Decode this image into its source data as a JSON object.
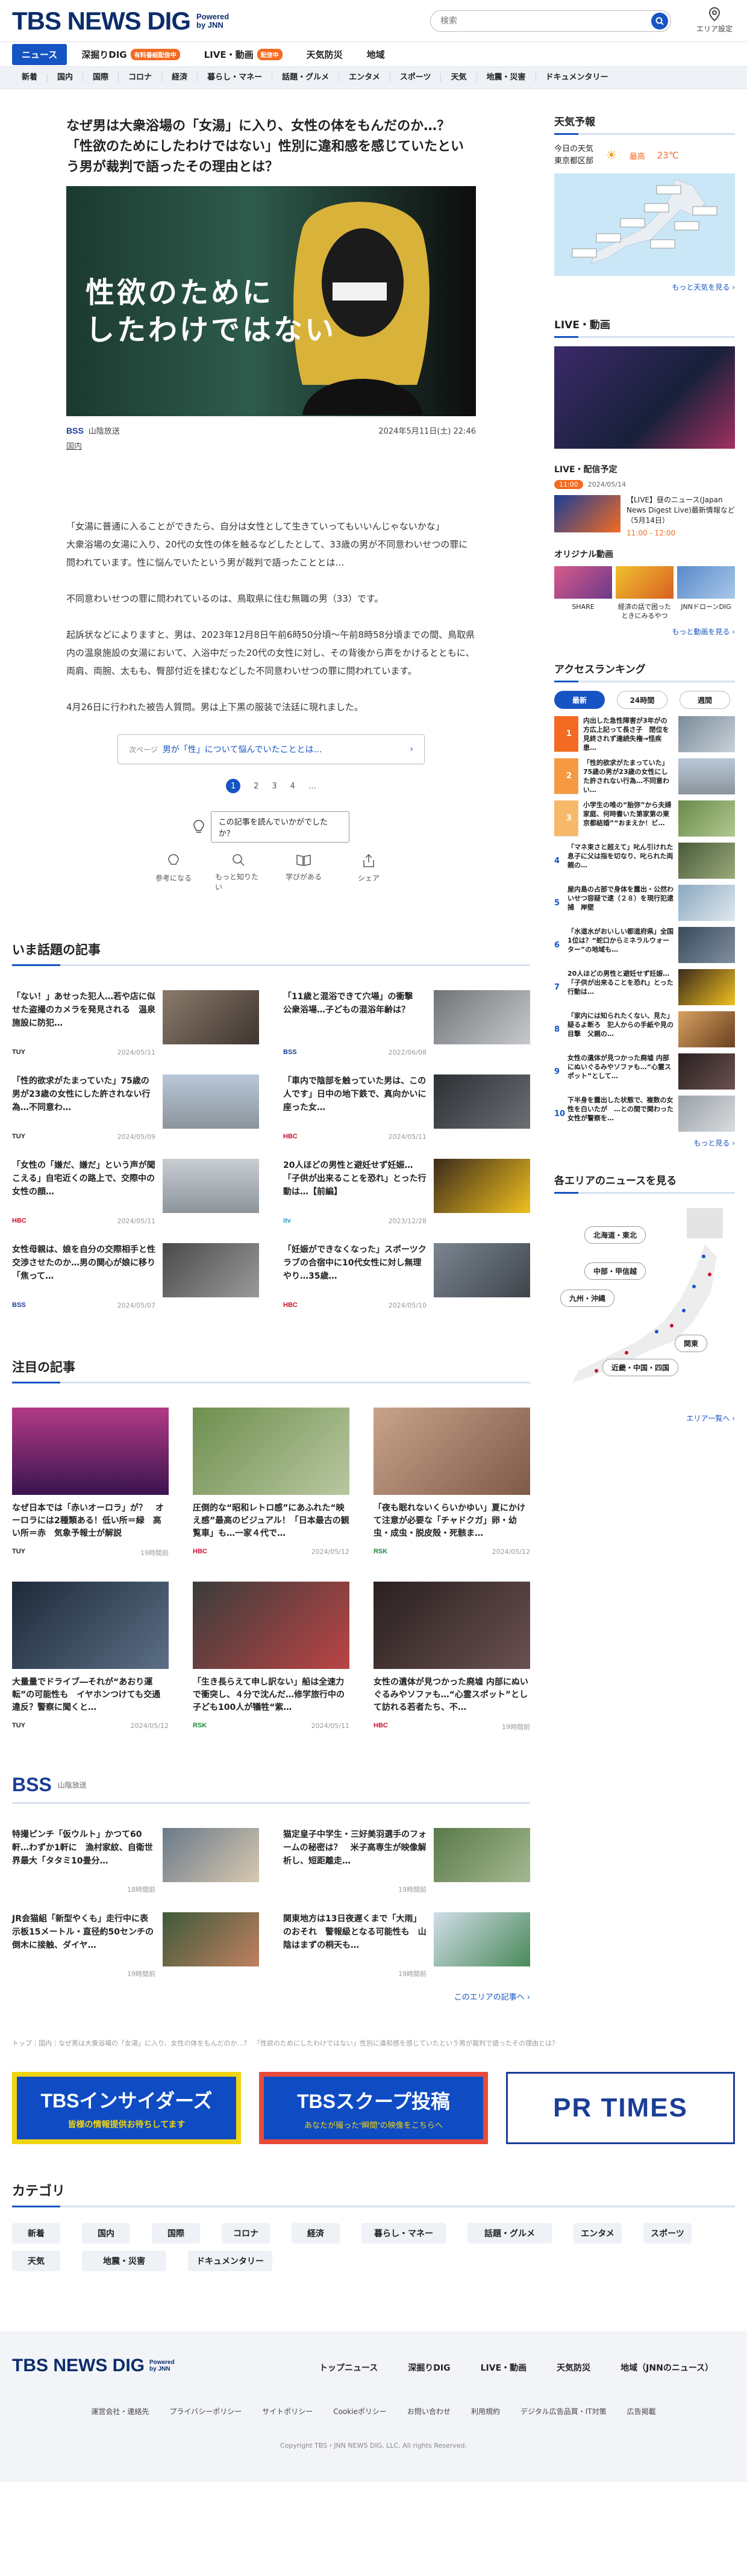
{
  "header": {
    "logo": "TBS NEWS DIG",
    "powered": "Powered by JNN",
    "search_placeholder": "検索",
    "area_label": "エリア設定"
  },
  "nav": [
    {
      "label": "ニュース",
      "badge": ""
    },
    {
      "label": "深掘りDIG",
      "badge": "有料番組配信中"
    },
    {
      "label": "LIVE・動画",
      "badge": "配信中"
    },
    {
      "label": "天気防災",
      "badge": ""
    },
    {
      "label": "地域",
      "badge": ""
    }
  ],
  "categories": [
    "新着",
    "国内",
    "国際",
    "コロナ",
    "経済",
    "暮らし・マネー",
    "話題・グルメ",
    "エンタメ",
    "スポーツ",
    "天気",
    "地震・災害",
    "ドキュメンタリー"
  ],
  "article": {
    "title": "なぜ男は大衆浴場の「女湯」に入り、女性の体をもんだのか…？　「性欲のためにしたわけではない」性別に違和感を感じていたという男が裁判で語ったその理由とは？",
    "image_caption": [
      "性欲のために",
      "したわけではない"
    ],
    "source": "山陰放送",
    "source_logo": "BSS",
    "date": "2024年5月11日(土) 22:46",
    "tag": "国内",
    "paragraphs": [
      "「女湯に普通に入ることができたら、自分は女性として生きていってもいいんじゃないかな」\n大衆浴場の女湯に入り、20代の女性の体を触るなどしたとして、33歳の男が不同意わいせつの罪に問われています。性に悩んでいたという男が裁判で語ったこととは…",
      "不同意わいせつの罪に問われているのは、鳥取県に住む無職の男（33）です。",
      "起訴状などによりますと、男は、2023年12月8日午前6時50分頃～午前8時58分頃までの間、鳥取県内の温泉施設の女湯において、入浴中だった20代の女性に対し、その背後から声をかけるとともに、両肩、両腕、太もも、臀部付近を揉むなどした不同意わいせつの罪に問われています。",
      "4月26日に行われた被告人質問。男は上下黒の服装で法廷に現れました。"
    ],
    "next_prefix": "次ページ",
    "next_label": "男が「性」について悩んでいたこととは…",
    "pages": [
      "1",
      "2",
      "3",
      "4",
      "…"
    ],
    "react_question": "この記事を読んでいかがでしたか？",
    "reactions": [
      "参考になる",
      "もっと知りたい",
      "学びがある",
      "シェア"
    ]
  },
  "trending": {
    "title": "いま話題の記事",
    "items": [
      {
        "title": "「ない！」あせった犯人…若や店に似せた盗撮のカメラを発見される　温泉施設に防犯…",
        "source": "TUY",
        "date": "2024/05/11"
      },
      {
        "title": "「11歳と混浴できて穴場」の衝撃　公衆浴場…子どもの混浴年齢は？",
        "source": "BSS",
        "date": "2022/06/08"
      },
      {
        "title": "「性的欲求がたまっていた」75歳の男が23歳の女性にした許されない行為…不同意わ…",
        "source": "TUY",
        "date": "2024/05/09"
      },
      {
        "title": "「車内で陰部を触っていた男は、この人です」日中の地下鉄で、真向かいに座った女…",
        "source": "HBC",
        "date": "2024/05/11"
      },
      {
        "title": "「女性の「嫌だ、嫌だ」という声が聞こえる」自宅近くの路上で、交際中の女性の顔…",
        "source": "HBC",
        "date": "2024/05/11"
      },
      {
        "title": "20人ほどの男性と避妊せず妊娠…「子供が出来ることを恐れ」とった行動は…【前編】",
        "source": "itv",
        "date": "2023/12/28"
      },
      {
        "title": "女性母親は、娘を自分の交際相手と性交渉させたのか…男の関心が娘に移り「焦って…",
        "source": "BSS",
        "date": "2024/05/07"
      },
      {
        "title": "「妊娠ができなくなった」スポーツクラブの合宿中に10代女性に対し無理やり…35歳…",
        "source": "HBC",
        "date": "2024/05/10"
      }
    ]
  },
  "featured": {
    "title": "注目の記事",
    "items": [
      {
        "title": "なぜ日本では「赤いオーロラ」が？　オーロラには2種類ある！低い所＝緑　高い所＝赤　気象予報士が解説",
        "source": "TUY",
        "date": "19時間前"
      },
      {
        "title": "圧倒的な“昭和レトロ感”にあふれた“映え感”最高のビジュアル！「日本最古の観覧車」も…一家４代で…",
        "source": "HBC",
        "date": "2024/05/12"
      },
      {
        "title": "「夜も眠れないくらいかゆい」夏にかけて注意が必要な「チャドクガ」卵・幼虫・成虫・脱皮殻・死骸ま…",
        "source": "RSK",
        "date": "2024/05/12"
      },
      {
        "title": "大量量でドライブ―それが“あおり運転”の可能性も　イヤホンつけても交通違反？警察に聞くと…",
        "source": "TUY",
        "date": "2024/05/12"
      },
      {
        "title": "「生き長らえて申し訳ない」船は全速力で衝突し、４分で沈んだ…修学旅行中の子ども100人が犠牲“紫…",
        "source": "RSK",
        "date": "2024/05/11"
      },
      {
        "title": "女性の遺体が見つかった廃墟 内部にぬいぐるみやソファも…“心霊スポット”として訪れる若者たち、不…",
        "source": "HBC",
        "date": "19時間前"
      }
    ]
  },
  "regional": {
    "logo": "BSS",
    "region": "山陰放送",
    "items": [
      {
        "title": "特撮ピンチ「仮ウルト」かつて60軒…わずか1軒に　漁村家紋、自衛世界最大「タタミ10畳分…",
        "date": "18時間前"
      },
      {
        "title": "猫定皇子中学生・三好美羽選手のフォームの秘密は？　米子高専生が映像解析し、短距離走…",
        "date": "19時間前"
      },
      {
        "title": "JR会猫組「新型やくも」走行中に表示板15メートル・直径約50センチの倒木に接触、ダイヤ…",
        "date": "19時間前"
      },
      {
        "title": "関東地方は13日夜遅くまで「大雨」のおそれ　警報級となる可能性も　山陰はまずの桐天も…",
        "date": "19時間前"
      }
    ],
    "more": "このエリアの記事へ ›"
  },
  "sidebar": {
    "weather": {
      "title": "天気予報",
      "label": "今日の天気",
      "location": "東京都区部",
      "temp_label": "最高",
      "temp": "23℃",
      "more": "もっと天気を見る ›"
    },
    "live": {
      "title": "LIVE・動画",
      "sched_title": "LIVE・配信予定",
      "sched_time": "11:00",
      "sched_date": "2024/05/14",
      "sched_text": "【LIVE】昼のニュース(Japan News Digest Live)最新情報など（5月14日）",
      "sched_when": "11:00 - 12:00",
      "orig_title": "オリジナル動画",
      "orig": [
        "SHARE",
        "経済の話で困ったときにみるやつ",
        "JNNドローンDIG"
      ],
      "more": "もっと動画を見る ›"
    },
    "ranking": {
      "title": "アクセスランキング",
      "tabs": [
        "最新",
        "24時間",
        "週間"
      ],
      "items": [
        "内出した急性障害が3年がの方広上記って長さ子　閉位を見終されず連続失権→怪疾患…",
        "「性的欲求がたまっていた」75歳の男が23歳の女性にした許されない行為…不同意わい…",
        "小学生の唯の“胎弥”から夫婦家庭、何時書いた第家第の東京都結婚”“おまえか！ビ…",
        "「マネ束さと超えて」叱ん引けれた息子に父は指を切なり、叱られた両親の…",
        "屋内島の占部で身体を露出・公然わいせつ容疑で逮（２８）を現行犯逮捕　岸壁",
        "「水道水がおいしい都道府県」全国1位は？“蛇口からミネラルウォーター”の地域も…",
        "20人ほどの男性と避妊せず妊娠…「子供が出来ることを恐れ」とった行動は…",
        "「家内には知られたくない、見た」疑るよ断ろ　犯人からの手紙や見の目撃　父親の…",
        "女性の遺体が見つかった廃墟 内部にぬいぐるみやソファも…“心霊スポット”として…",
        "下半身を露出した状態で、複数の女性を白いたが　…との間で関わった女性が警察を…"
      ],
      "more": "もっと見る ›"
    },
    "areas": {
      "title": "各エリアのニュースを見る",
      "buttons": [
        "北海道・東北",
        "中部・甲信越",
        "九州・沖縄",
        "関東",
        "近畿・中国・四国"
      ],
      "more": "エリア一覧へ ›"
    }
  },
  "breadcrumbs": "トップ｜国内｜なぜ男は大衆浴場の「女湯」に入り、女性の体をもんだのか…？　「性欲のためにしたわけではない」性別に違和感を感じていたという男が裁判で語ったその理由とは？",
  "banners": {
    "insiders": "TBSインサイダーズ",
    "insiders_sub": "皆様の情報提供お待ちしてます",
    "scoop": "TBSスクープ投稿",
    "scoop_sub": "あなたが撮った“瞬間”の映像をこちらへ",
    "prtimes": "PR TIMES"
  },
  "category_section": {
    "title": "カテゴリ",
    "items": [
      "新着",
      "国内",
      "国際",
      "コロナ",
      "経済",
      "暮らし・マネー",
      "話題・グルメ",
      "エンタメ",
      "スポーツ",
      "天気",
      "地震・災害",
      "ドキュメンタリー"
    ]
  },
  "footer": {
    "nav": [
      "トップニュース",
      "深掘りDIG",
      "LIVE・動画",
      "天気防災",
      "地域（JNNのニュース）"
    ],
    "links": [
      "運営会社・連絡先",
      "プライバシーポリシー",
      "サイトポリシー",
      "Cookieポリシー",
      "お問い合わせ",
      "利用規約",
      "デジタル広告品質・IT対策",
      "広告掲載"
    ],
    "copyright": "Copyright TBS・JNN NEWS DIG, LLC. All rights Reserved."
  },
  "colors": {
    "brand": "#0c2d6b",
    "accent": "#1654c4",
    "orange": "#f36b22"
  }
}
